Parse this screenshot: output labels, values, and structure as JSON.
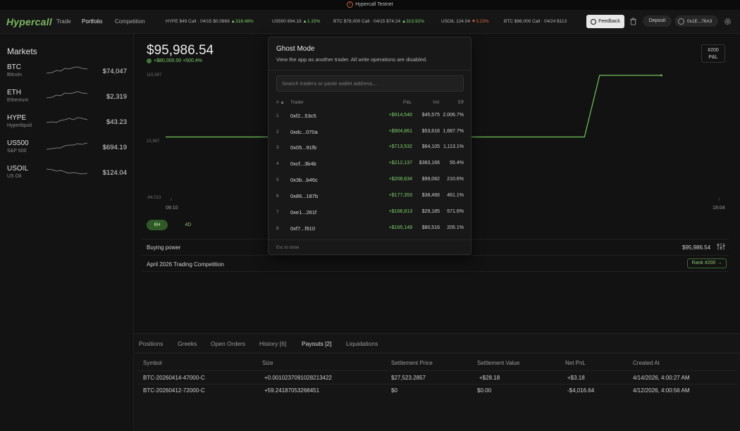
{
  "banner": {
    "text": "Hypercall Testnet"
  },
  "nav": {
    "logo": "Hypercall",
    "links": [
      "Trade",
      "Portfolio",
      "Competition"
    ],
    "tickers": [
      {
        "label": "HYPE $49 Call · 04/15",
        "price": "$0.0869",
        "change": "▲318.48%",
        "dir": "up"
      },
      {
        "label": "US500",
        "price": "694.19",
        "change": "▲1.15%",
        "dir": "up"
      },
      {
        "label": "BTC $78,000 Call · 04/15",
        "price": "$74.24",
        "change": "▲313.92%",
        "dir": "up"
      },
      {
        "label": "USOIL",
        "price": "124.04",
        "change": "▼3.23%",
        "dir": "down"
      },
      {
        "label": "BTC $86,000 Call · 04/24",
        "price": "$113",
        "change": "",
        "dir": "up"
      }
    ],
    "feedback": "Feedback",
    "deposit": "Deposit",
    "wallet": "0x1E...76A3"
  },
  "sidebar": {
    "title": "Markets",
    "markets": [
      {
        "symbol": "BTC",
        "name": "Bitcoin",
        "price": "$74,047"
      },
      {
        "symbol": "ETH",
        "name": "Ethereum",
        "price": "$2,319"
      },
      {
        "symbol": "HYPE",
        "name": "Hyperliquid",
        "price": "$43.23"
      },
      {
        "symbol": "US500",
        "name": "S&P 500",
        "price": "$694.19"
      },
      {
        "symbol": "USOIL",
        "name": "US Oil",
        "price": "$124.04"
      }
    ]
  },
  "main": {
    "balance": "$95,986.54",
    "pnl_change": "+$80,000.00 +500.4%",
    "rank_badge": {
      "rank": "#200",
      "label": "P&L"
    },
    "ranges": [
      "8H",
      "4D"
    ],
    "active_range": "8H",
    "buying_power_label": "Buying power",
    "buying_power_value": "$95,986.54",
    "competition_label": "April 2026 Trading Competition",
    "competition_rank": "Rank #200 →"
  },
  "chart_data": {
    "type": "line",
    "y_ticks": [
      "115,987",
      "15,987",
      "-84,013"
    ],
    "x_ticks": [
      "09:10",
      "19:04"
    ],
    "series": [
      {
        "values": [
          15987,
          15987,
          15987,
          115987,
          115987
        ]
      }
    ],
    "ylim": [
      -84013,
      115987
    ],
    "color": "#6fc65a",
    "grid": false
  },
  "bottom": {
    "tabs": [
      "Positions",
      "Greeks",
      "Open Orders",
      "History [6]",
      "Payouts [2]",
      "Liquidations"
    ],
    "active_tab": "Payouts [2]",
    "columns": [
      "Symbol",
      "Size",
      "Settlement Price",
      "Settlement Value",
      "Net PnL",
      "Created At"
    ],
    "rows": [
      {
        "symbol": "BTC-20260414-47000-C",
        "size": "+0.0010237091028213422",
        "settlement_price": "$27,523.2857",
        "settlement_value": "+$28.18",
        "net_pnl": "+$3.18",
        "created_at": "4/14/2026, 4:00:27 AM"
      },
      {
        "symbol": "BTC-20260412-72000-C",
        "size": "+59.24187053268451",
        "settlement_price": "$0",
        "settlement_value": "$0.00",
        "net_pnl": "-$4,016.64",
        "created_at": "4/12/2026, 4:00:56 AM"
      }
    ]
  },
  "modal": {
    "title": "Ghost Mode",
    "subtitle": "View the app as another trader. All write operations are disabled.",
    "search_placeholder": "Search traders or paste wallet address...",
    "columns": {
      "rank": "# ▲",
      "trader": "Trader",
      "pnl": "P&L",
      "vol": "Vol",
      "eff": "Eff"
    },
    "rows": [
      {
        "rank": "1",
        "trader": "0xf2...53c5",
        "pnl": "+$914,540",
        "vol": "$45,575",
        "eff": "2,006.7%"
      },
      {
        "rank": "2",
        "trader": "0xdc...070a",
        "pnl": "+$904,861",
        "vol": "$53,616",
        "eff": "1,687.7%"
      },
      {
        "rank": "3",
        "trader": "0x05...91fb",
        "pnl": "+$713,532",
        "vol": "$64,105",
        "eff": "1,113.1%"
      },
      {
        "rank": "4",
        "trader": "0xcf...3b4b",
        "pnl": "+$212,137",
        "vol": "$383,166",
        "eff": "55.4%"
      },
      {
        "rank": "5",
        "trader": "0x3b...b46c",
        "pnl": "+$208,634",
        "vol": "$99,082",
        "eff": "210.6%"
      },
      {
        "rank": "6",
        "trader": "0x86...187b",
        "pnl": "+$177,353",
        "vol": "$38,466",
        "eff": "461.1%"
      },
      {
        "rank": "7",
        "trader": "0xe1...261f",
        "pnl": "+$166,813",
        "vol": "$29,185",
        "eff": "571.6%"
      },
      {
        "rank": "8",
        "trader": "0xf7...f910",
        "pnl": "+$165,149",
        "vol": "$80,516",
        "eff": "205.1%"
      }
    ],
    "esc_hint": "Esc to close"
  }
}
